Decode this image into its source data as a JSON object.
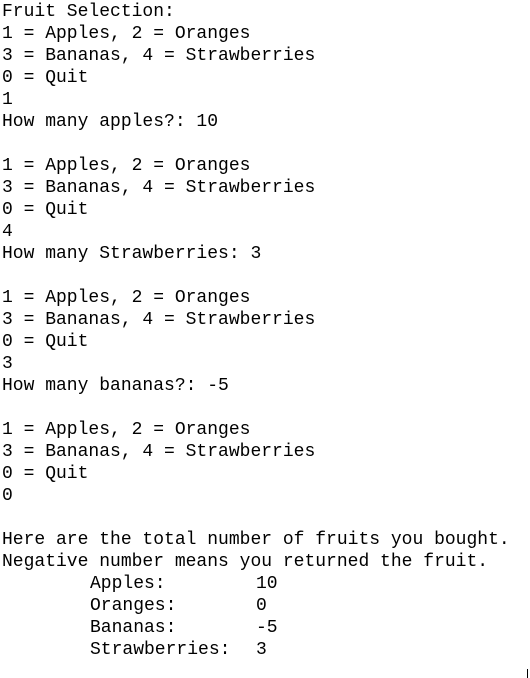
{
  "console": {
    "title": "Fruit Selection:",
    "rounds": [
      {
        "menu": [
          "1 = Apples, 2 = Oranges",
          "3 = Bananas, 4 = Strawberries",
          "0 = Quit"
        ],
        "choice": "1",
        "prompt": "How many apples?: 10"
      },
      {
        "menu": [
          "1 = Apples, 2 = Oranges",
          "3 = Bananas, 4 = Strawberries",
          "0 = Quit"
        ],
        "choice": "4",
        "prompt": "How many Strawberries: 3"
      },
      {
        "menu": [
          "1 = Apples, 2 = Oranges",
          "3 = Bananas, 4 = Strawberries",
          "0 = Quit"
        ],
        "choice": "3",
        "prompt": "How many bananas?: -5"
      },
      {
        "menu": [
          "1 = Apples, 2 = Oranges",
          "3 = Bananas, 4 = Strawberries",
          "0 = Quit"
        ],
        "choice": "0"
      }
    ],
    "summary": {
      "heading": "Here are the total number of fruits you bought.",
      "note": "Negative number means you returned the fruit.",
      "rows": [
        {
          "label": "Apples:",
          "value": "10"
        },
        {
          "label": "Oranges:",
          "value": "0"
        },
        {
          "label": "Bananas:",
          "value": "-5"
        },
        {
          "label": "Strawberries:",
          "value": "3"
        }
      ]
    }
  }
}
